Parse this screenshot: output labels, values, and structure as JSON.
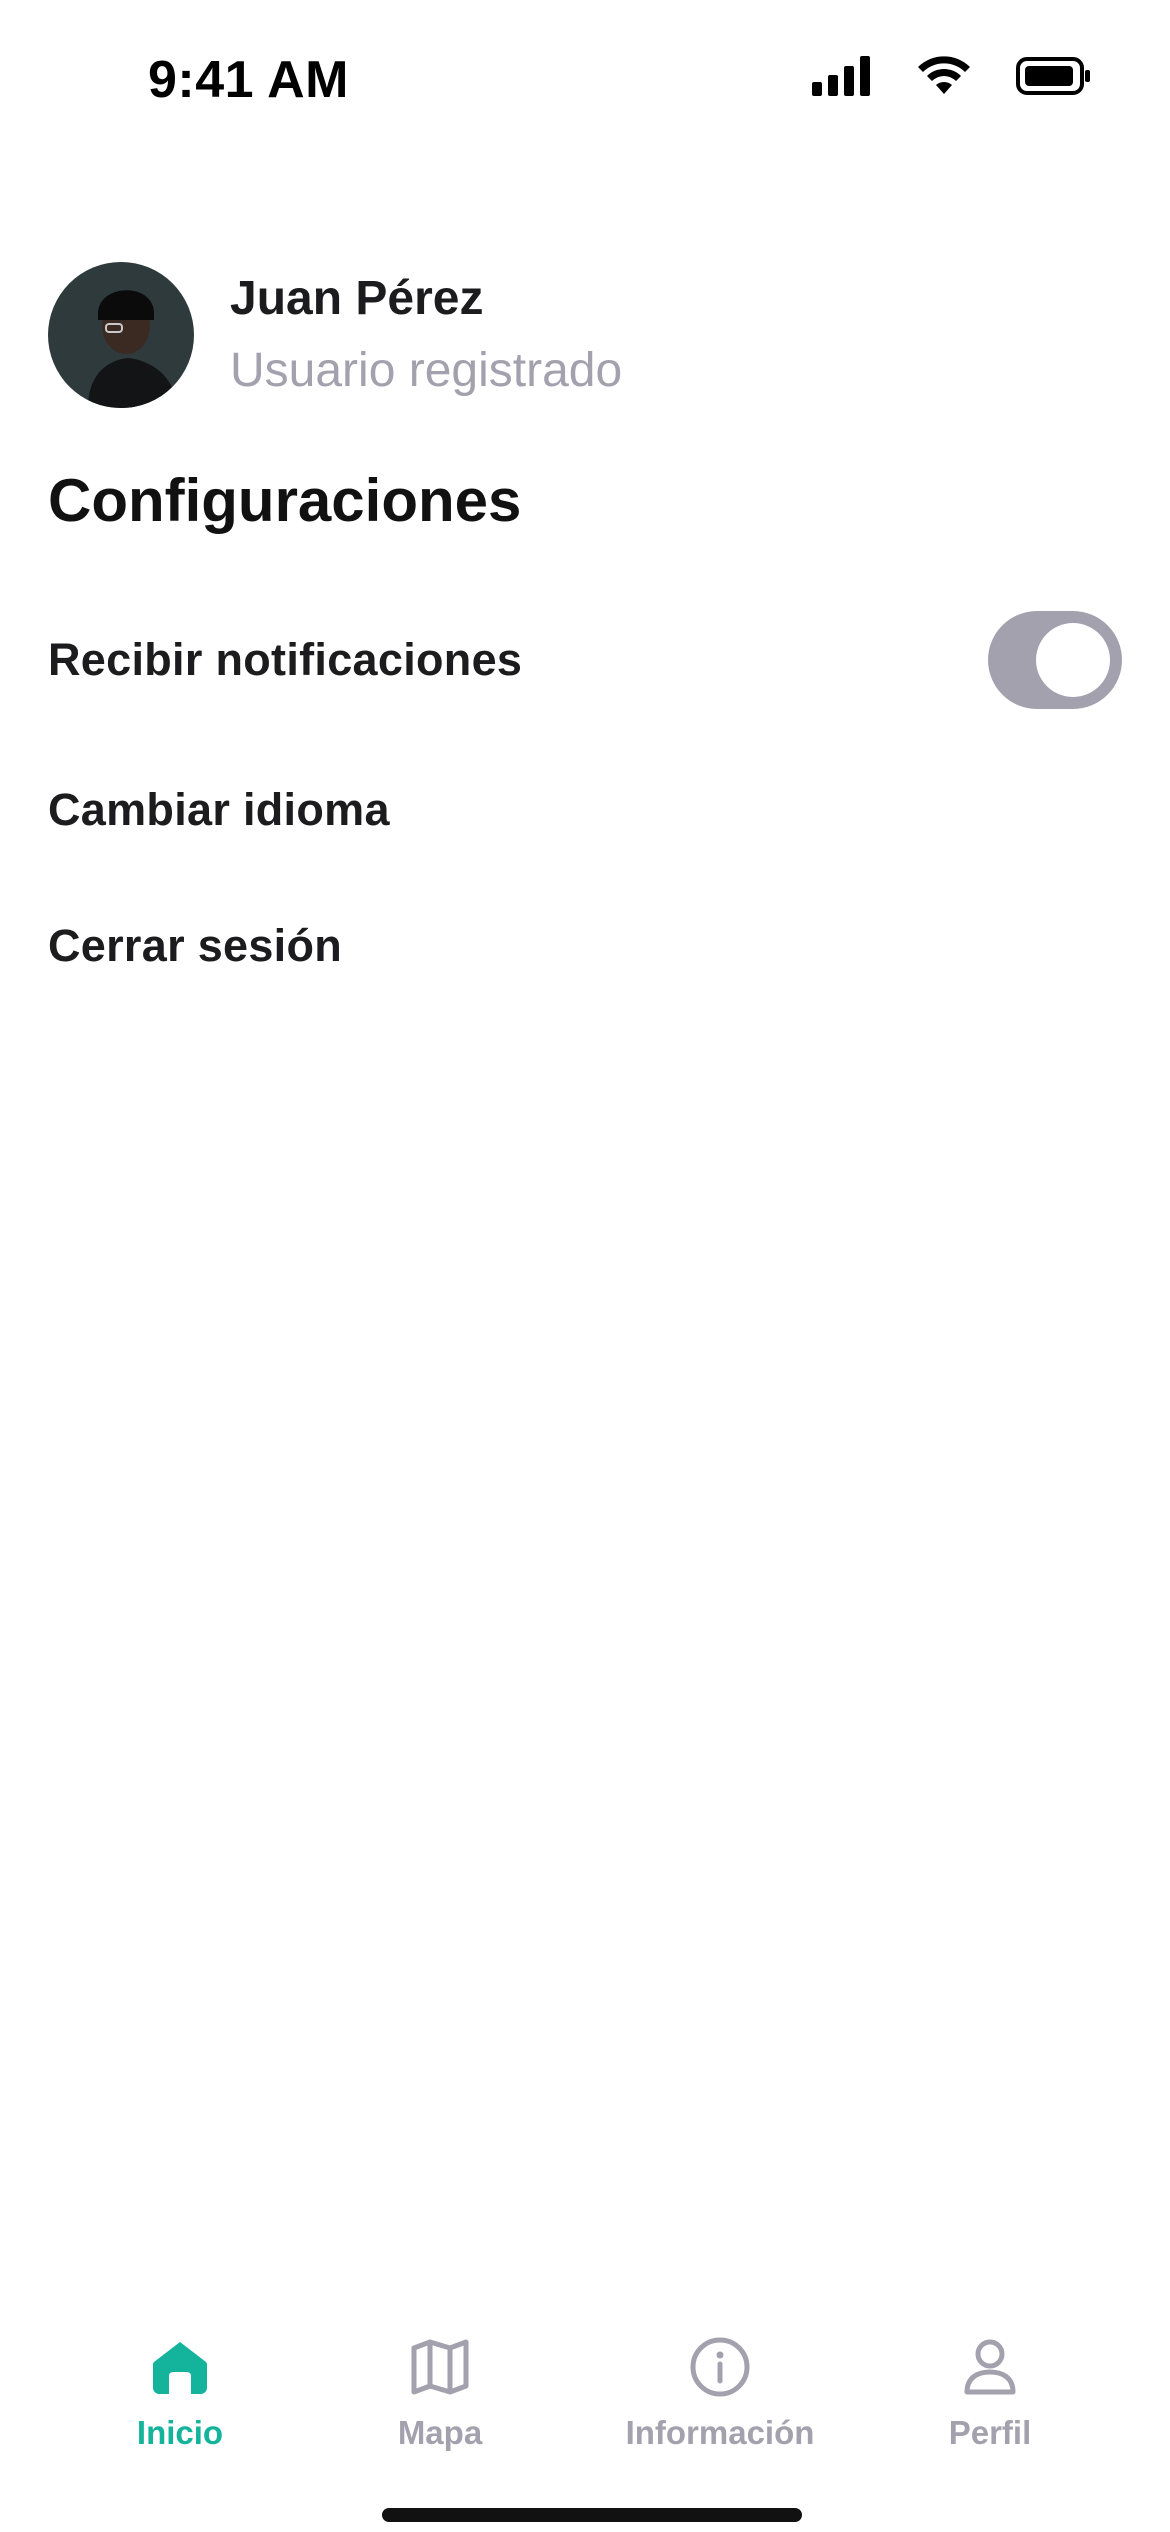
{
  "status_bar": {
    "time": "9:41 AM",
    "icons": [
      "cellular-signal-icon",
      "wifi-icon",
      "battery-icon"
    ]
  },
  "profile": {
    "name": "Juan Pérez",
    "role": "Usuario registrado",
    "avatar_icon": "user-avatar-photo"
  },
  "settings": {
    "title": "Configuraciones",
    "notifications_label": "Recibir notificaciones",
    "notifications_enabled": false,
    "language_label": "Cambiar idioma",
    "logout_label": "Cerrar sesión"
  },
  "tab_bar": {
    "active_tab": "Inicio",
    "tabs": [
      {
        "label": "Inicio",
        "icon": "home-icon"
      },
      {
        "label": "Mapa",
        "icon": "map-icon"
      },
      {
        "label": "Información",
        "icon": "info-icon"
      },
      {
        "label": "Perfil",
        "icon": "person-icon"
      }
    ]
  },
  "colors": {
    "accent": "#14b39c",
    "inactive": "#a3a1ad",
    "text": "#1c1c1e",
    "toggle_off": "#a3a1ad"
  }
}
